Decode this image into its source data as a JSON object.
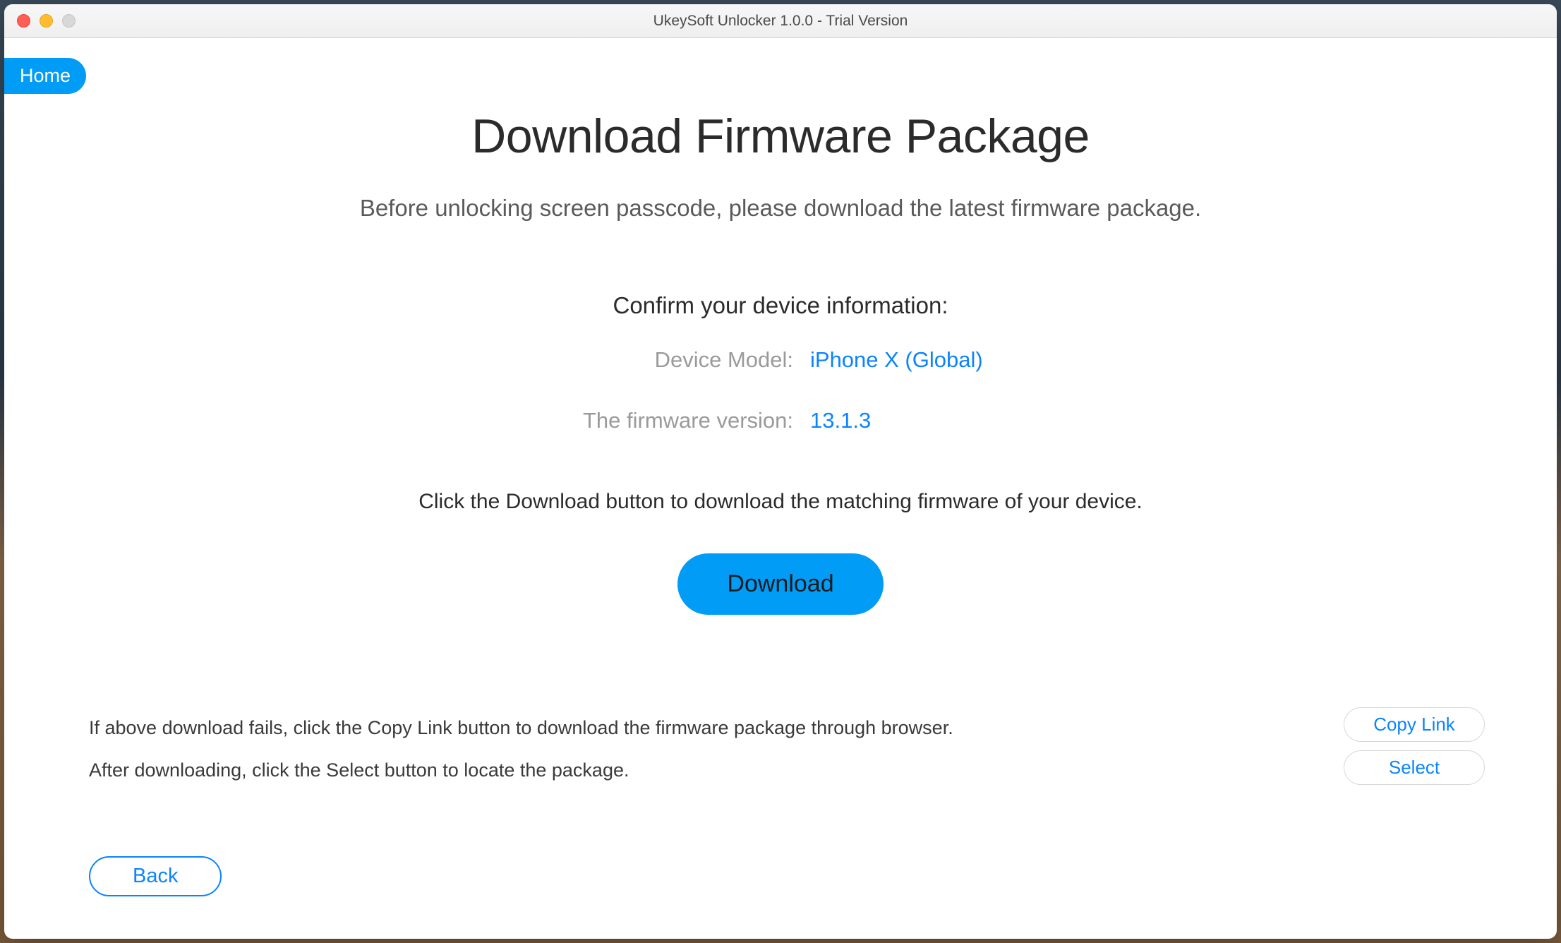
{
  "window": {
    "title": "UkeySoft Unlocker 1.0.0 - Trial Version"
  },
  "nav": {
    "home_label": "Home"
  },
  "page": {
    "title": "Download Firmware Package",
    "subtitle": "Before unlocking screen passcode, please download the latest firmware package.",
    "confirm_heading": "Confirm your device information:",
    "device_model_label": "Device Model:",
    "device_model_value": "iPhone X (Global)",
    "firmware_label": "The firmware version:",
    "firmware_value": "13.1.3",
    "instruction": "Click the Download button to download the matching firmware of your device.",
    "download_label": "Download"
  },
  "help": {
    "line1": "If above download fails, click the Copy Link button to download the firmware package through browser.",
    "line2": "After downloading, click the Select button to locate the package.",
    "copy_link_label": "Copy Link",
    "select_label": "Select"
  },
  "footer": {
    "back_label": "Back"
  },
  "colors": {
    "accent_blue": "#009cf6",
    "link_blue": "#0a84ff"
  }
}
